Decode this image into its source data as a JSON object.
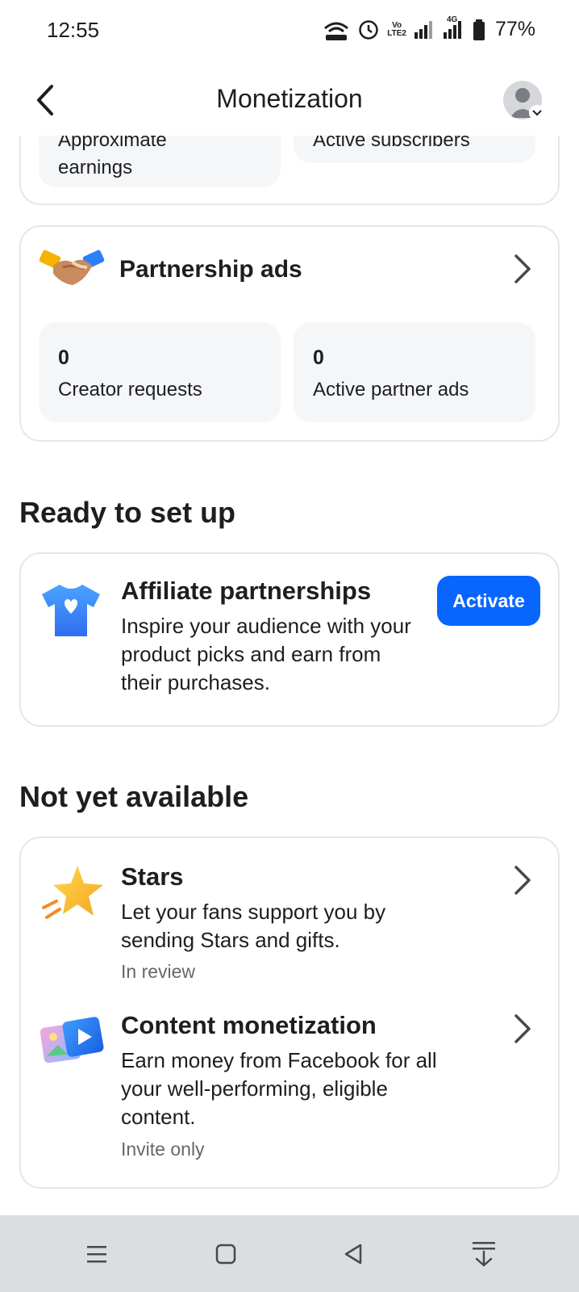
{
  "status_bar": {
    "time": "12:55",
    "volte_label_top": "Vo",
    "volte_label_bottom": "LTE2",
    "network_label": "4G",
    "battery": "77%"
  },
  "header": {
    "title": "Monetization",
    "back_icon": "chevron-left-icon",
    "avatar_icon": "profile-avatar-icon"
  },
  "top_card": {
    "left_label": "earnings",
    "left_label_cut": "Approximate",
    "right_label_cut": "Active subscribers"
  },
  "partnership_ads": {
    "title": "Partnership ads",
    "icon": "handshake-icon",
    "stats": [
      {
        "value": "0",
        "label": "Creator requests"
      },
      {
        "value": "0",
        "label": "Active partner ads"
      }
    ]
  },
  "ready_section": {
    "heading": "Ready to set up",
    "items": [
      {
        "title": "Affiliate partnerships",
        "description": "Inspire your audience with your product picks and earn from their purchases.",
        "icon": "tshirt-heart-icon",
        "button": "Activate"
      }
    ]
  },
  "not_available_section": {
    "heading": "Not yet available",
    "items": [
      {
        "title": "Stars",
        "description": "Let your fans support you by sending Stars and gifts.",
        "status": "In review",
        "icon": "star-icon"
      },
      {
        "title": "Content monetization",
        "description": "Earn money from Facebook for all your well-performing, eligible content.",
        "status": "Invite only",
        "icon": "media-play-icon"
      }
    ]
  },
  "colors": {
    "accent": "#0866ff",
    "card_border": "#e4e6eb",
    "stat_bg": "#f5f6f8",
    "secondary_text": "#65676b",
    "nav_bar": "#dcdde0"
  }
}
